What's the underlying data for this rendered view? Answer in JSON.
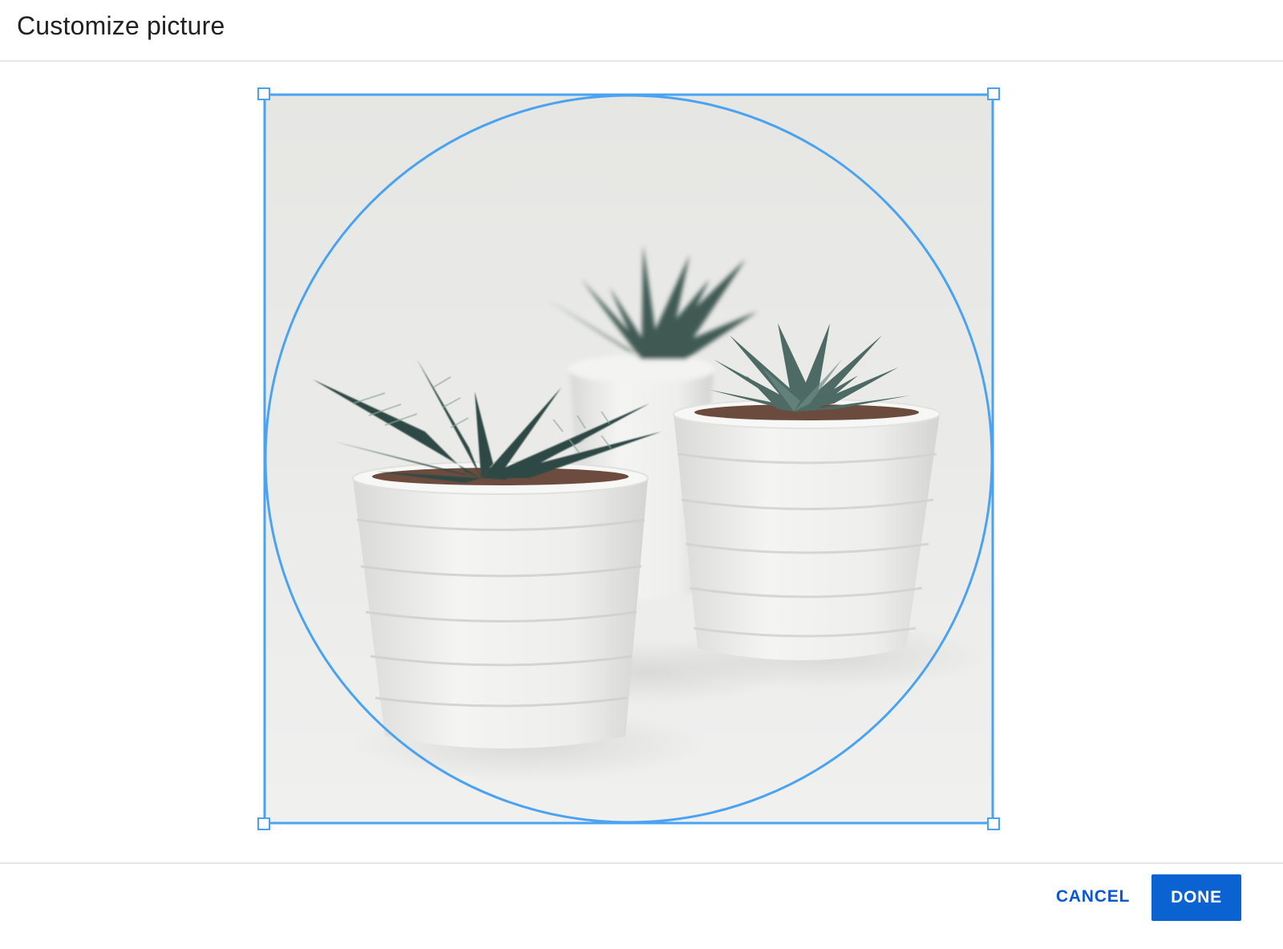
{
  "dialog": {
    "title": "Customize picture"
  },
  "crop": {
    "shape": "circle",
    "accent_color": "#4aa3f2",
    "handles": [
      "top-left",
      "top-right",
      "bottom-left",
      "bottom-right"
    ]
  },
  "image": {
    "icon": "photo-icon"
  },
  "footer": {
    "cancel_label": "CANCEL",
    "done_label": "DONE",
    "primary_color": "#0b63d1"
  }
}
